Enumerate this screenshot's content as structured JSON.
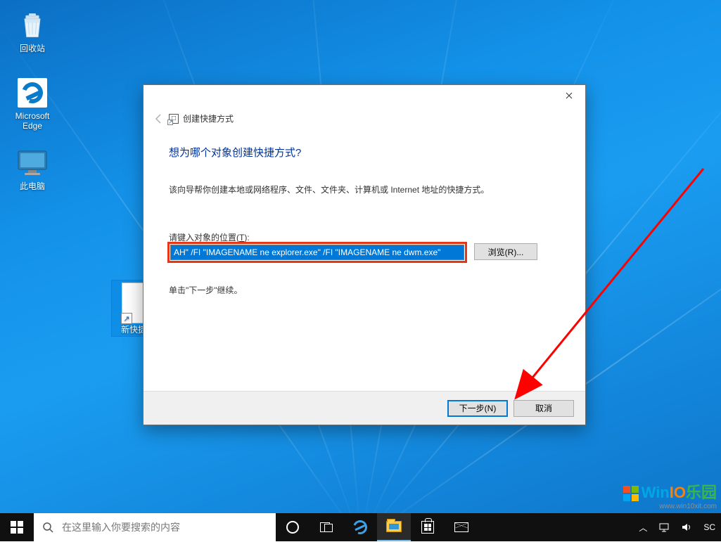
{
  "desktop_icons": {
    "recycle_bin": "回收站",
    "edge": "Microsoft Edge",
    "this_pc": "此电脑",
    "new_shortcut": "新快捷方"
  },
  "dialog": {
    "title": "创建快捷方式",
    "headline": "想为哪个对象创建快捷方式?",
    "description": "该向导帮你创建本地或网络程序、文件、文件夹、计算机或 Internet 地址的快捷方式。",
    "field_label_prefix": "请键入对象的位置(",
    "field_label_key": "T",
    "field_label_suffix": "):",
    "input_value": "AH\" /FI \"IMAGENAME ne explorer.exe\" /FI \"IMAGENAME ne dwm.exe\"",
    "browse": "浏览(R)...",
    "continue_hint": "单击\"下一步\"继续。",
    "next": "下一步(N)",
    "cancel": "取消"
  },
  "taskbar": {
    "search_placeholder": "在这里输入你要搜索的内容",
    "tray_text": "SC"
  },
  "watermark": {
    "brand1": "Win",
    "brand2": "IO",
    "brand3": "乐园",
    "url": "www.win10xit.com"
  }
}
